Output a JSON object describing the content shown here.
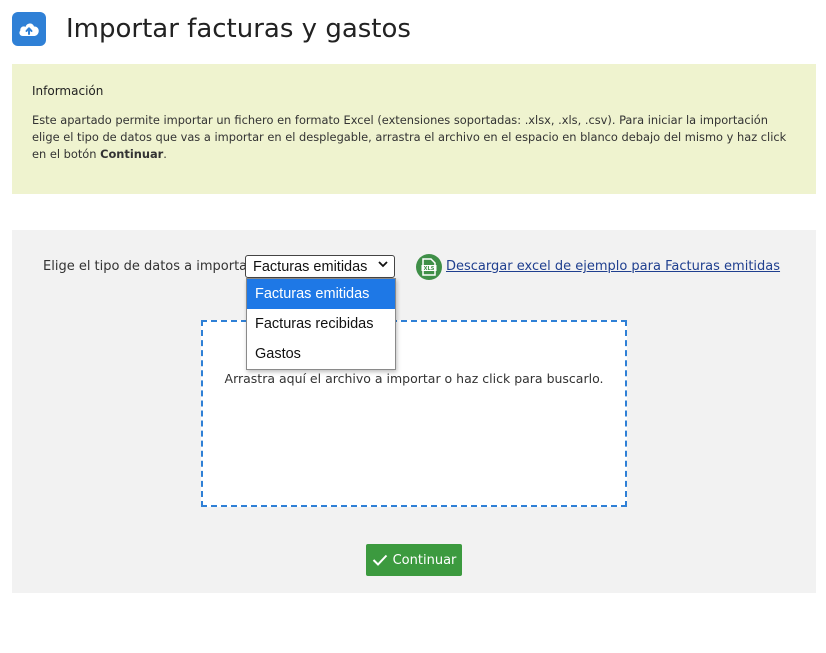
{
  "header": {
    "icon": "cloud-upload-icon",
    "title": "Importar facturas y gastos"
  },
  "info": {
    "title": "Información",
    "text_before": "Este apartado permite importar un fichero en formato Excel (extensiones soportadas: .xlsx, .xls, .csv). Para iniciar la importación elige el tipo de datos que vas a importar en el desplegable, arrastra el archivo en el espacio en blanco debajo del mismo y haz click en el botón ",
    "text_bold": "Continuar",
    "text_after": "."
  },
  "form": {
    "type_label": "Elige el tipo de datos a importar:",
    "select_value": "Facturas emitidas",
    "options": [
      "Facturas emitidas",
      "Facturas recibidas",
      "Gastos"
    ],
    "download_icon": "xls-file-icon",
    "download_link": "Descargar excel de ejemplo para Facturas emitidas",
    "dropzone_text": "Arrastra aquí el archivo a importar o haz click para buscarlo.",
    "continue_label": "Continuar"
  },
  "colors": {
    "accent": "#2f80d6",
    "info_background": "#eff3cf",
    "button_green": "#3c9a3f",
    "option_highlight": "#1e78e6"
  }
}
